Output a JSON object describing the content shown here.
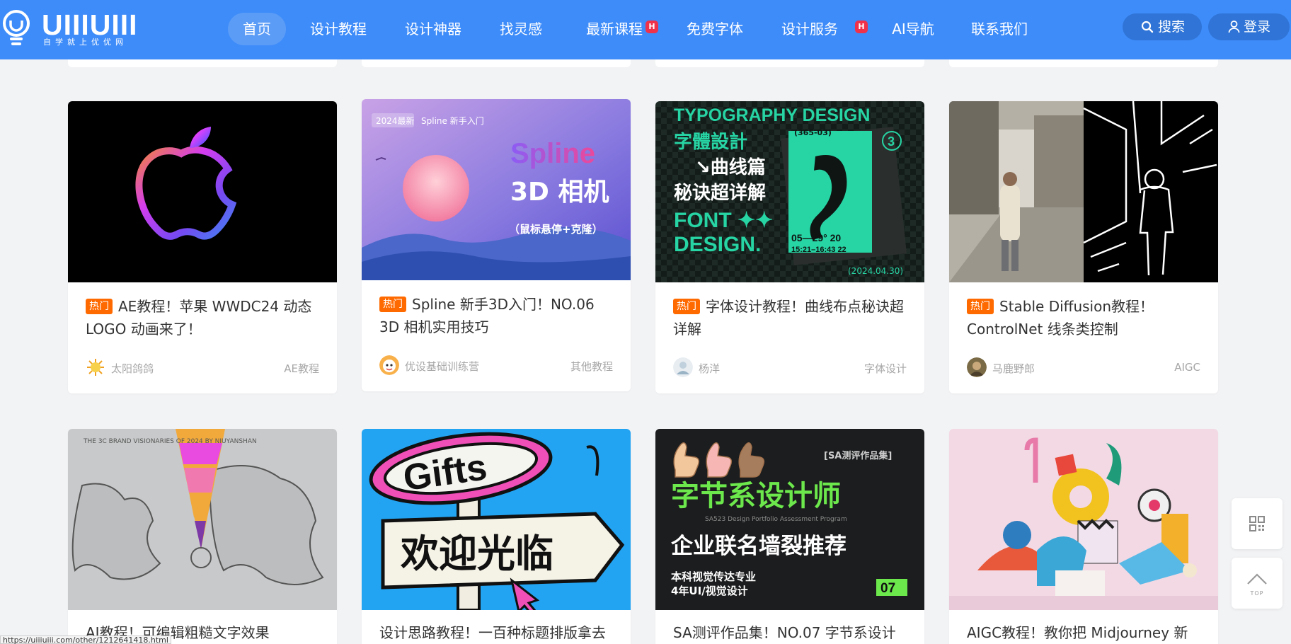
{
  "header": {
    "logo_text": "UIIIUIII",
    "logo_sub": "自学就上优优网",
    "nav": [
      {
        "label": "首页",
        "active": true,
        "hot": false
      },
      {
        "label": "设计教程",
        "active": false,
        "hot": false
      },
      {
        "label": "设计神器",
        "active": false,
        "hot": false
      },
      {
        "label": "找灵感",
        "active": false,
        "hot": false
      },
      {
        "label": "最新课程",
        "active": false,
        "hot": true
      },
      {
        "label": "免费字体",
        "active": false,
        "hot": false
      },
      {
        "label": "设计服务",
        "active": false,
        "hot": true
      },
      {
        "label": "AI导航",
        "active": false,
        "hot": false
      },
      {
        "label": "联系我们",
        "active": false,
        "hot": false
      }
    ],
    "hot_badge": "H",
    "search_label": "搜索",
    "login_label": "登录"
  },
  "cards_row1": [
    {
      "tag": "热门",
      "title": "AE教程！苹果 WWDC24 动态 LOGO 动画来了！",
      "author": "太阳鸽鸽",
      "category": "AE教程"
    },
    {
      "tag": "热门",
      "title": "Spline 新手3D入门！NO.06 3D 相机实用技巧",
      "author": "优设基础训练营",
      "category": "其他教程",
      "thumb": {
        "badge_year": "2024最新",
        "badge_text": "Spline 新手入门",
        "heading": "Spline",
        "subheading": "3D 相机",
        "note": "（鼠标悬停+克隆）"
      }
    },
    {
      "tag": "热门",
      "title": "字体设计教程！曲线布点秘诀超详解",
      "author": "杨洋",
      "category": "字体设计",
      "thumb": {
        "line1": "TYPOGRAPHY DESIGN",
        "line2": "字體設計",
        "line3": "↘曲线篇",
        "line4": "秘诀超详解",
        "line5": "FONT ✦✦",
        "line6": "DESIGN.",
        "num": "3",
        "date1": "05—29° 20",
        "date2": "15:21–16:43 22",
        "date3": "(2024.04.30)",
        "badge": "(365-03)"
      }
    },
    {
      "tag": "热门",
      "title": "Stable Diffusion教程！ControlNet 线条类控制",
      "author": "马鹿野郎",
      "category": "AIGC"
    }
  ],
  "cards_row2": [
    {
      "title": "AI教程！可编辑粗糙文字效果",
      "thumb": {
        "caption": "THE 3C BRAND VISIONARIES OF 2024 BY NIUYANSHAN"
      }
    },
    {
      "title": "设计思路教程！一百种标题排版拿去",
      "thumb": {
        "sign1": "Gifts",
        "sign2": "欢迎光临"
      }
    },
    {
      "title": "SA测评作品集！NO.07 字节系设计",
      "thumb": {
        "tag": "[SA测评作品集]",
        "line1": "字节系设计师",
        "line2": "SA523 Design Portfolio Assessment Program",
        "line3": "企业联名墙裂推荐",
        "line4": "本科视觉传达专业",
        "line5": "4年UI/视觉设计",
        "num": "07"
      }
    },
    {
      "title": "AIGC教程！教你把 Midjourney 新"
    }
  ],
  "side_tools": {
    "top_label": "TOP"
  },
  "status_url": "https://uiiiuiii.com/other/1212641418.html"
}
